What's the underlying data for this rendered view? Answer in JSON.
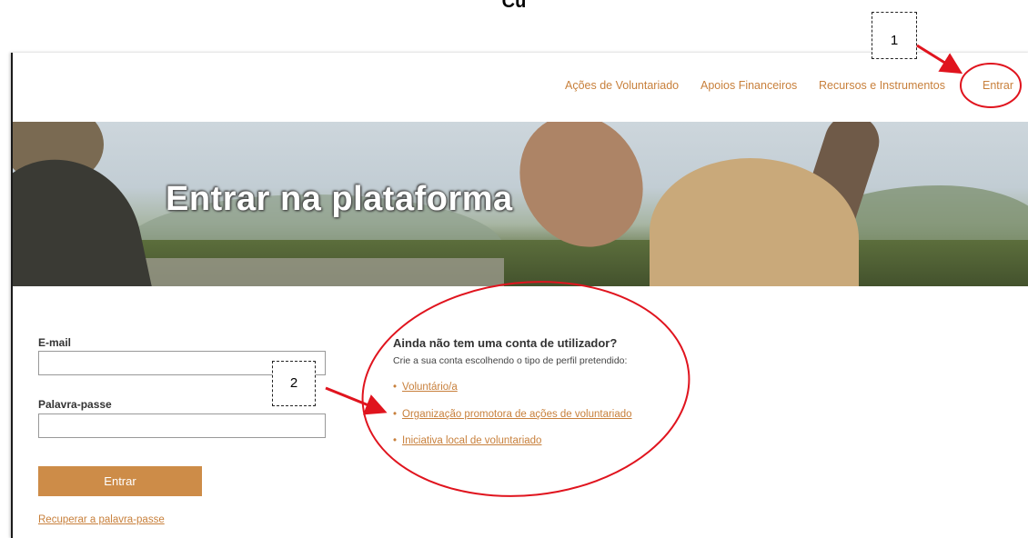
{
  "top_fragment": "Cu",
  "nav": {
    "items": [
      {
        "label": "Ações de Voluntariado"
      },
      {
        "label": "Apoios Financeiros"
      },
      {
        "label": "Recursos e Instrumentos"
      },
      {
        "label": "Entrar"
      }
    ]
  },
  "hero": {
    "title": "Entrar na plataforma"
  },
  "login": {
    "email_label": "E-mail",
    "email_value": "",
    "password_label": "Palavra-passe",
    "password_value": "",
    "submit_label": "Entrar",
    "recover_label": "Recuperar a palavra-passe"
  },
  "signup": {
    "title": "Ainda não tem uma conta de utilizador?",
    "subtitle": "Crie a sua conta escolhendo o tipo de perfil pretendido:",
    "options": [
      {
        "label": "Voluntário/a"
      },
      {
        "label": "Organização promotora de ações de voluntariado"
      },
      {
        "label": "Iniciativa local de voluntariado"
      }
    ]
  },
  "annotations": {
    "callouts": [
      {
        "label": "1"
      },
      {
        "label": "2"
      }
    ],
    "colors": {
      "highlight": "#e0141e",
      "accent": "#c8803c",
      "button": "#cd8c48"
    }
  }
}
